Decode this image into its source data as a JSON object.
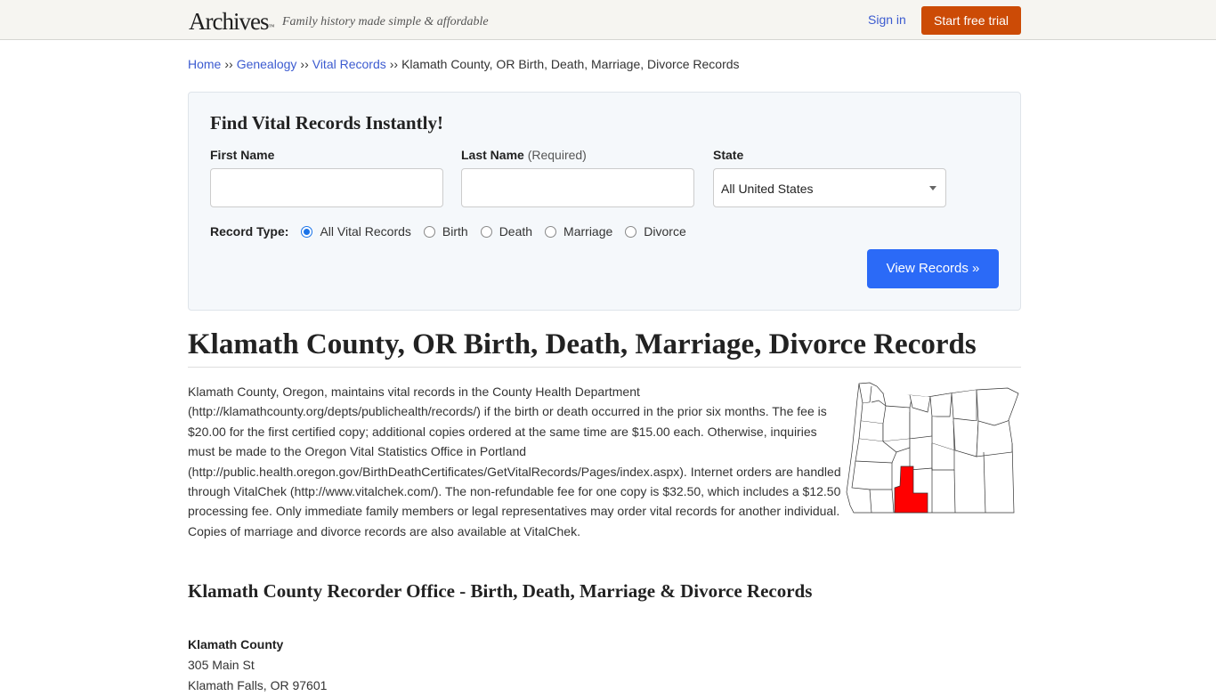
{
  "header": {
    "logo": "Archives",
    "logo_mark": "™",
    "tagline": "Family history made simple & affordable",
    "signin_label": "Sign in",
    "trial_label": "Start free trial",
    "colors": {
      "trial_button": "#cc4b06",
      "link": "#3c5bd0"
    }
  },
  "breadcrumb": {
    "items": [
      "Home",
      "Genealogy",
      "Vital Records"
    ],
    "separator": "››",
    "current": "Klamath County, OR Birth, Death, Marriage, Divorce Records"
  },
  "search": {
    "title": "Find Vital Records Instantly!",
    "first_name_label": "First Name",
    "first_name_value": "",
    "last_name_label": "Last Name",
    "last_name_required": "(Required)",
    "last_name_value": "",
    "state_label": "State",
    "state_value": "All United States",
    "record_type_label": "Record Type:",
    "record_types": [
      {
        "label": "All Vital Records",
        "checked": true
      },
      {
        "label": "Birth",
        "checked": false
      },
      {
        "label": "Death",
        "checked": false
      },
      {
        "label": "Marriage",
        "checked": false
      },
      {
        "label": "Divorce",
        "checked": false
      }
    ],
    "submit_label": "View Records »",
    "colors": {
      "submit_button": "#2b6af7"
    }
  },
  "page": {
    "title": "Klamath County, OR Birth, Death, Marriage, Divorce Records",
    "intro": "Klamath County, Oregon, maintains vital records in the County Health Department (http://klamathcounty.org/depts/publichealth/records/) if the birth or death occurred in the prior six months. The fee is $20.00 for the first certified copy; additional copies ordered at the same time are $15.00 each. Otherwise, inquiries must be made to the Oregon Vital Statistics Office in Portland (http://public.health.oregon.gov/BirthDeathCertificates/GetVitalRecords/Pages/index.aspx). Internet orders are handled through VitalChek (http://www.vitalchek.com/). The non-refundable fee for one copy is $32.50, which includes a $12.50 processing fee. Only immediate family members or legal representatives may order vital records for another individual. Copies of marriage and divorce records are also available at VitalChek.",
    "map_alt": "Oregon county map with Klamath County highlighted",
    "map_highlight_color": "#ff0000",
    "section_title": "Klamath County Recorder Office - Birth, Death, Marriage & Divorce Records",
    "office": {
      "name": "Klamath County",
      "address1": "305 Main St",
      "address2": "Klamath Falls, OR 97601"
    }
  }
}
